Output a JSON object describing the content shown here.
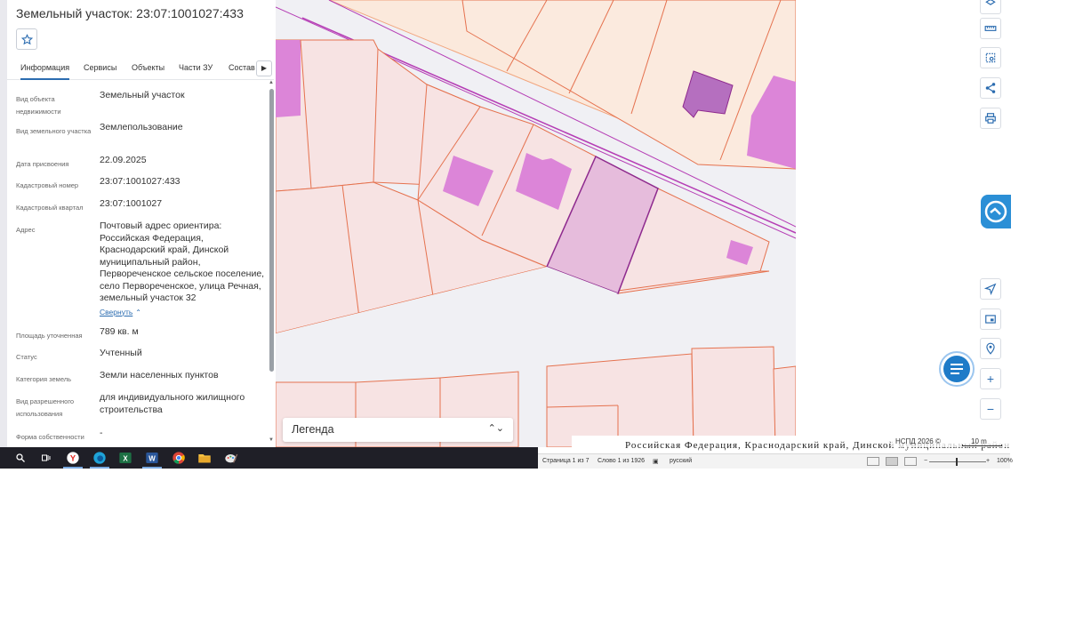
{
  "panel": {
    "title": "Земельный участок: 23:07:1001027:433",
    "favorite_icon": "star-icon",
    "tabs": [
      {
        "label": "Информация",
        "active": true
      },
      {
        "label": "Сервисы"
      },
      {
        "label": "Объекты"
      },
      {
        "label": "Части ЗУ"
      },
      {
        "label": "Состав"
      }
    ],
    "fields": {
      "object_type": {
        "label": "Вид объекта недвижимости",
        "value": "Земельный участок"
      },
      "land_type": {
        "label": "Вид земельного участка",
        "value": "Землепользование"
      },
      "assigned_date": {
        "label": "Дата присвоения",
        "value": "22.09.2025"
      },
      "cadastral_number": {
        "label": "Кадастровый номер",
        "value": "23:07:1001027:433"
      },
      "cadastral_quarter": {
        "label": "Кадастровый квартал",
        "value": "23:07:1001027"
      },
      "address": {
        "label": "Адрес",
        "value": "Почтовый адрес ориентира: Российская Федерация, Краснодарский край, Динской муниципальный район, Первореченское сельское поселение, село Первореченское, улица Речная, земельный участок 32",
        "collapse_link": "Свернуть"
      },
      "area": {
        "label": "Площадь уточненная",
        "value": "789 кв. м"
      },
      "status": {
        "label": "Статус",
        "value": "Учтенный"
      },
      "land_category": {
        "label": "Категория земель",
        "value": "Земли населенных пунктов"
      },
      "permitted_use": {
        "label": "Вид разрешенного использования",
        "value": "для индивидуального жилищного строительства"
      },
      "ownership": {
        "label": "Форма собственности",
        "value": "-"
      }
    }
  },
  "map": {
    "legend_label": "Легенда",
    "attribution": "НСПД 2026 ©",
    "scale_label": "10 m",
    "colors": {
      "parcel_fill": "#f7e3e3",
      "parcel_stroke": "#e5724f",
      "building": "#dc85d8",
      "selected_fill": "#e6bcdc",
      "selected_stroke": "#8e2a8e",
      "road": "#f0f0f4",
      "zone_line": "#b53db5"
    }
  },
  "tools": [
    {
      "name": "layers-icon"
    },
    {
      "name": "ruler-icon"
    },
    {
      "name": "select-area-icon"
    },
    {
      "name": "share-icon"
    },
    {
      "name": "print-icon"
    },
    {
      "name": "locate-icon"
    },
    {
      "name": "minimap-icon"
    },
    {
      "name": "geo-search-icon"
    },
    {
      "name": "zoom-in-icon"
    },
    {
      "name": "zoom-out-icon"
    }
  ],
  "document_strip": {
    "text": "Российская Федерация, Краснодарский край, Динской муниципальный район,"
  },
  "taskbar": {
    "icons": [
      "search-icon",
      "task-view-icon",
      "yandex-browser-icon",
      "edge-icon",
      "excel-icon",
      "word-icon",
      "chrome-icon",
      "file-explorer-icon",
      "paint-icon"
    ]
  },
  "statusbar": {
    "page": "Страница 1 из 7",
    "words": "Слово 1 из 1926",
    "language": "русский",
    "zoom": "100%"
  }
}
